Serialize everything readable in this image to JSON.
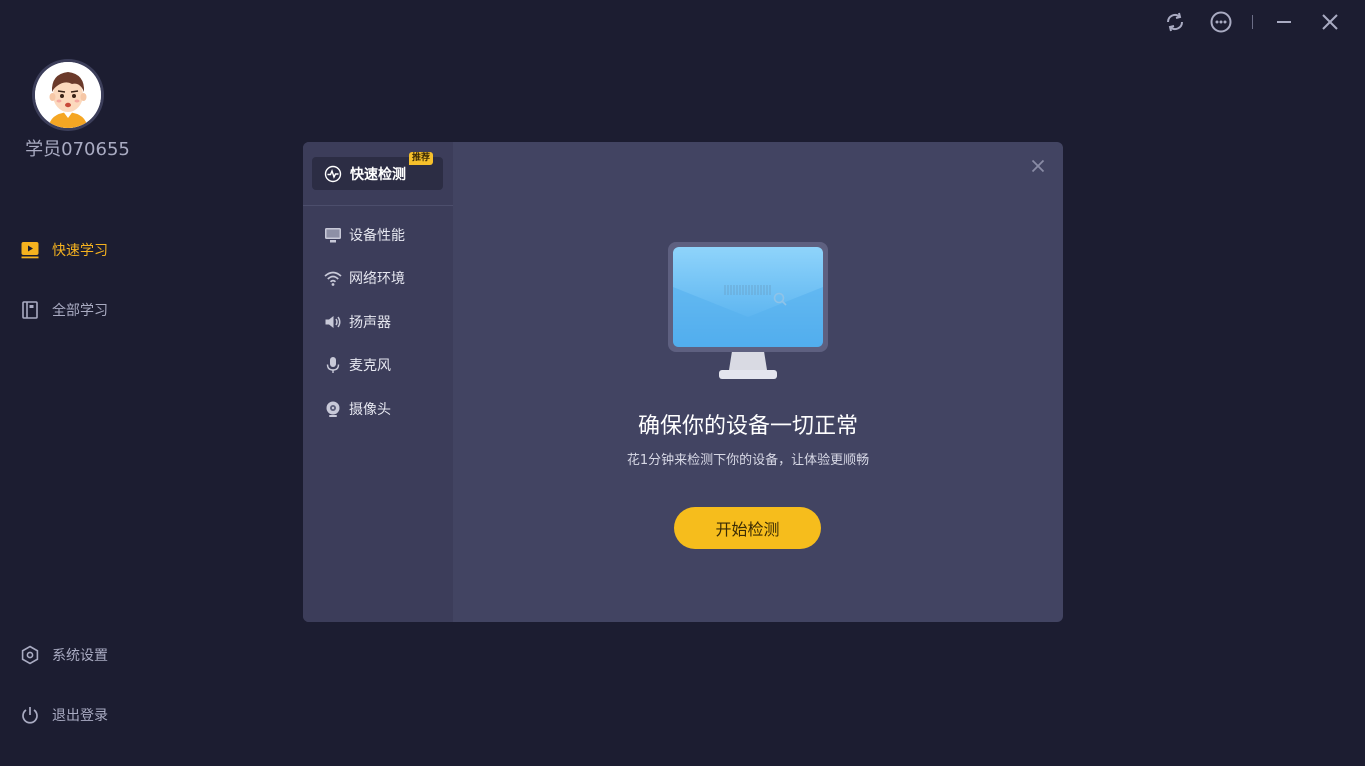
{
  "window": {
    "refresh_icon": "refresh-icon",
    "more_icon": "more-icon",
    "minimize_icon": "minimize-icon",
    "close_icon": "close-icon"
  },
  "user": {
    "name": "学员070655",
    "avatar_icon": "user-avatar"
  },
  "sidebar": {
    "items": [
      {
        "label": "快速学习",
        "icon": "play-icon",
        "active": true
      },
      {
        "label": "全部学习",
        "icon": "book-icon",
        "active": false
      }
    ],
    "bottom": [
      {
        "label": "系统设置",
        "icon": "settings-icon"
      },
      {
        "label": "退出登录",
        "icon": "power-icon"
      }
    ]
  },
  "modal": {
    "quick_tab": {
      "label": "快速检测",
      "badge": "推荐",
      "icon": "pulse-icon"
    },
    "checks": [
      {
        "label": "设备性能",
        "icon": "monitor-icon"
      },
      {
        "label": "网络环境",
        "icon": "wifi-icon"
      },
      {
        "label": "扬声器",
        "icon": "speaker-icon"
      },
      {
        "label": "麦克风",
        "icon": "microphone-icon"
      },
      {
        "label": "摄像头",
        "icon": "camera-icon"
      }
    ],
    "title": "确保你的设备一切正常",
    "subtitle": "花1分钟来检测下你的设备，让体验更顺畅",
    "start_button": "开始检测"
  },
  "colors": {
    "background": "#1c1d31",
    "accent": "#f5b21f",
    "modal_bg": "#424462",
    "modal_side_bg": "#3c3d5a",
    "button": "#f6bd1c"
  }
}
